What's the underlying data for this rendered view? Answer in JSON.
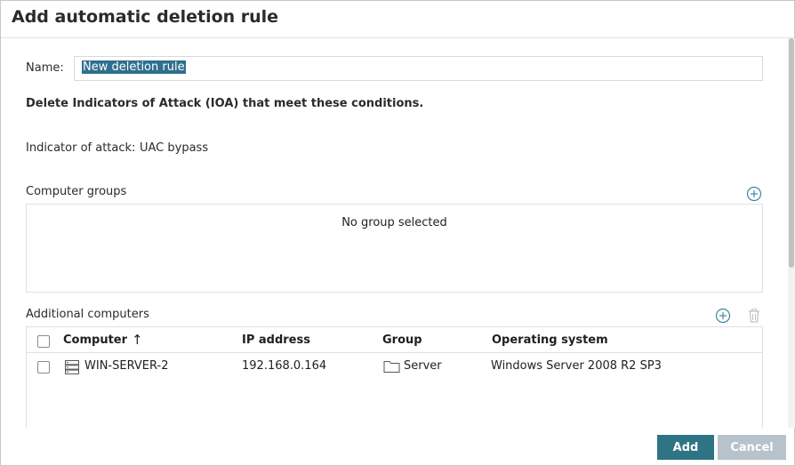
{
  "dialog": {
    "title": "Add automatic deletion rule"
  },
  "form": {
    "name_label": "Name:",
    "name_value": "New deletion rule",
    "description": "Delete Indicators of Attack (IOA) that meet these conditions.",
    "indicator_label": "Indicator of attack:",
    "indicator_value": "UAC bypass"
  },
  "computer_groups": {
    "label": "Computer groups",
    "empty_text": "No group selected",
    "add_icon": "plus-circle-icon"
  },
  "additional_computers": {
    "label": "Additional computers",
    "add_icon": "plus-circle-icon",
    "delete_icon": "trash-icon",
    "columns": {
      "computer": "Computer",
      "sort_indicator": "↑",
      "ip": "IP address",
      "group": "Group",
      "os": "Operating system"
    },
    "rows": [
      {
        "computer": "WIN-SERVER-2",
        "computer_icon": "server-icon",
        "ip": "192.168.0.164",
        "group": "Server",
        "group_icon": "folder-icon",
        "os": "Windows Server 2008 R2 SP3",
        "checked": false
      }
    ]
  },
  "footer": {
    "add_label": "Add",
    "cancel_label": "Cancel"
  },
  "colors": {
    "accent": "#2e7484",
    "selection": "#2f6f8f",
    "cancel": "#b8c2cb",
    "icon": "#3a8aa0"
  }
}
